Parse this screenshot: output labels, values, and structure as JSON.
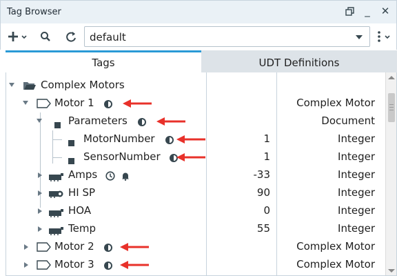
{
  "window": {
    "title": "Tag Browser",
    "restore_icon": "restore-icon",
    "minimize_glyph": "_",
    "close_glyph": "✕"
  },
  "toolbar": {
    "provider_value": "default"
  },
  "tabs": [
    {
      "label": "Tags",
      "active": true
    },
    {
      "label": "UDT Definitions",
      "active": false
    }
  ],
  "rows": [
    {
      "name": "Complex Motors",
      "value": "",
      "type": ""
    },
    {
      "name": "Motor 1",
      "value": "",
      "type": "Complex Motor"
    },
    {
      "name": "Parameters",
      "value": "",
      "type": "Document"
    },
    {
      "name": "MotorNumber",
      "value": "1",
      "type": "Integer"
    },
    {
      "name": "SensorNumber",
      "value": "1",
      "type": "Integer"
    },
    {
      "name": "Amps",
      "value": "-33",
      "type": "Integer"
    },
    {
      "name": "HI SP",
      "value": "90",
      "type": "Integer"
    },
    {
      "name": "HOA",
      "value": "0",
      "type": "Integer"
    },
    {
      "name": "Temp",
      "value": "55",
      "type": "Integer"
    },
    {
      "name": "Motor 2",
      "value": "",
      "type": "Complex Motor"
    },
    {
      "name": "Motor 3",
      "value": "",
      "type": "Complex Motor"
    }
  ],
  "colors": {
    "accent": "#2a9ad6",
    "annotation_arrow": "#e8312a"
  }
}
